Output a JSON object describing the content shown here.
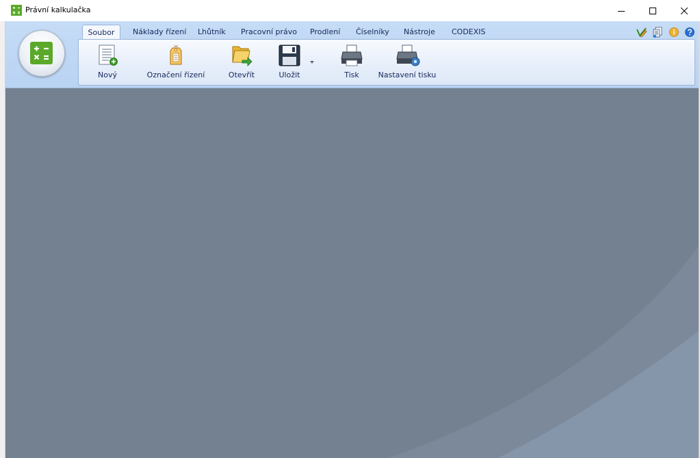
{
  "window": {
    "title": "Právní kalkulačka",
    "icon": "calculator-icon"
  },
  "window_controls": {
    "minimize": "minimize-icon",
    "maximize": "maximize-icon",
    "close": "close-icon"
  },
  "ribbon": {
    "tabs": [
      {
        "label": "Soubor",
        "active": true
      },
      {
        "label": "Náklady řízení",
        "active": false
      },
      {
        "label": "Lhůtník",
        "active": false
      },
      {
        "label": "Pracovní právo",
        "active": false
      },
      {
        "label": "Prodlení",
        "active": false
      },
      {
        "label": "Číselníky",
        "active": false
      },
      {
        "label": "Nástroje",
        "active": false
      },
      {
        "label": "CODEXIS",
        "active": false
      }
    ],
    "buttons": [
      {
        "label": "Nový",
        "icon": "new-document-icon"
      },
      {
        "label": "Označení řízení",
        "icon": "tag-icon"
      },
      {
        "label": "Otevřít",
        "icon": "open-folder-icon"
      },
      {
        "label": "Uložit",
        "icon": "save-floppy-icon"
      },
      {
        "label": "Tisk",
        "icon": "printer-icon"
      },
      {
        "label": "Nastavení tisku",
        "icon": "printer-settings-icon"
      }
    ],
    "quick_access_icons": [
      "edit-pencil-icon",
      "documents-icon",
      "info-icon",
      "help-icon"
    ]
  },
  "colors": {
    "ribbon_bg": "#c6dcf6",
    "workspace_bg": "#738190",
    "workspace_swoosh": "#8696aa",
    "app_green": "#5aa928"
  }
}
